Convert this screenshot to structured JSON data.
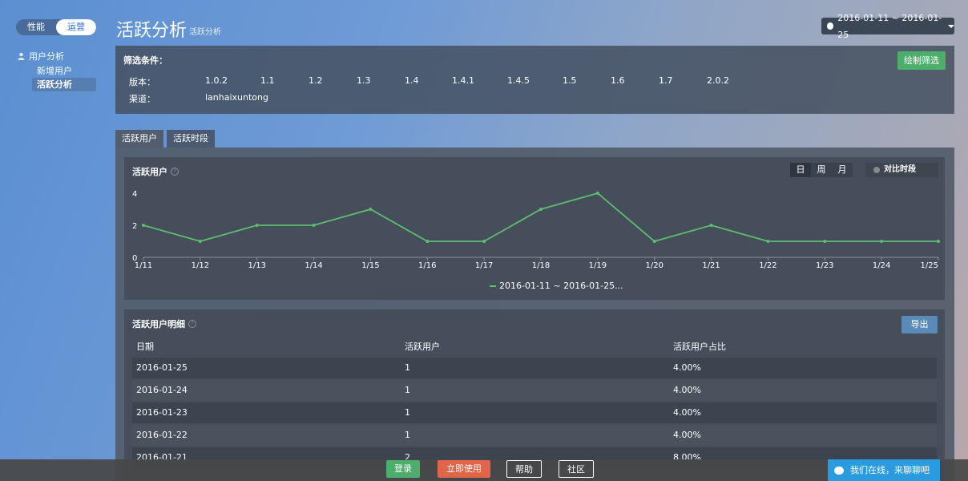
{
  "sidebar": {
    "segments": [
      "性能",
      "运营"
    ],
    "group": "用户分析",
    "items": [
      "新增用户",
      "活跃分析"
    ]
  },
  "header": {
    "title": "活跃分析",
    "subtitle": "活跃分析",
    "date_range": "2016-01-11 ~ 2016-01-25"
  },
  "filter": {
    "title": "筛选条件：",
    "button": "绘制筛选",
    "version_label": "版本：",
    "versions": [
      "1.0.2",
      "1.1",
      "1.2",
      "1.3",
      "1.4",
      "1.4.1",
      "1.4.5",
      "1.5",
      "1.6",
      "1.7",
      "2.0.2"
    ],
    "channel_label": "渠道：",
    "channel": "lanhaixuntong"
  },
  "tabs": [
    "活跃用户",
    "活跃时段"
  ],
  "chart_card": {
    "title": "活跃用户",
    "help": "?",
    "granularity": [
      "日",
      "周",
      "月"
    ],
    "compare": "对比时段"
  },
  "chart_data": {
    "type": "line",
    "x": [
      "1/11",
      "1/12",
      "1/13",
      "1/14",
      "1/15",
      "1/16",
      "1/17",
      "1/18",
      "1/19",
      "1/20",
      "1/21",
      "1/22",
      "1/23",
      "1/24",
      "1/25"
    ],
    "series": [
      {
        "name": "2016-01-11 ~ 2016-01-25...",
        "values": [
          2,
          1,
          2,
          2,
          3,
          1,
          1,
          3,
          4,
          1,
          2,
          1,
          1,
          1,
          1
        ]
      }
    ],
    "yticks": [
      0,
      2,
      4
    ],
    "ylim": [
      0,
      4
    ],
    "line_color": "#5cbf6e"
  },
  "table": {
    "title": "活跃用户明细",
    "help": "?",
    "export": "导出",
    "headers": [
      "日期",
      "活跃用户",
      "活跃用户占比"
    ],
    "rows": [
      [
        "2016-01-25",
        "1",
        "4.00%"
      ],
      [
        "2016-01-24",
        "1",
        "4.00%"
      ],
      [
        "2016-01-23",
        "1",
        "4.00%"
      ],
      [
        "2016-01-22",
        "1",
        "4.00%"
      ],
      [
        "2016-01-21",
        "2",
        "8.00%"
      ]
    ]
  },
  "bottom": {
    "login": "登录",
    "use_now": "立即使用",
    "help": "帮助",
    "community": "社区",
    "chat": "我们在线，来聊聊吧"
  }
}
